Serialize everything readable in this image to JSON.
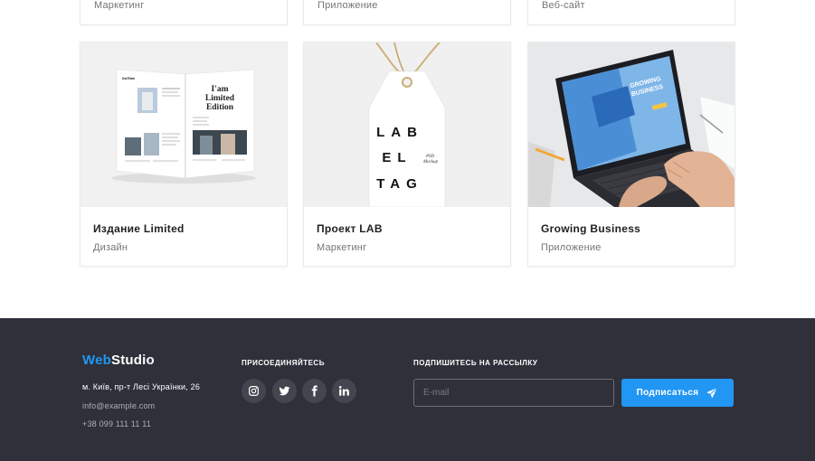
{
  "top_row": {
    "items": [
      {
        "category": "Маркетинг"
      },
      {
        "category": "Приложение"
      },
      {
        "category": "Веб-сайт"
      }
    ]
  },
  "portfolio": {
    "items": [
      {
        "title": "Издание Limited",
        "category": "Дизайн"
      },
      {
        "title": "Проект LAB",
        "category": "Маркетинг"
      },
      {
        "title": "Growing Business",
        "category": "Приложение"
      }
    ],
    "images": {
      "magazine": {
        "headline": "I'am Limited Edition",
        "brand": "Dal'Edm"
      },
      "label_tag": {
        "lines": [
          "LAB",
          "EL",
          "TAG"
        ],
        "note": "PSD Mockup"
      },
      "laptop": {
        "headline": "GROWING BUSINESS"
      }
    }
  },
  "footer": {
    "logo": {
      "part1": "Web",
      "part2": "Studio"
    },
    "address": "м. Київ, пр-т Лесі Українки, 26",
    "email": "info@example.com",
    "phone": "+38 099 111 11 11",
    "social_heading": "ПРИСОЕДИНЯЙТЕСЬ",
    "social_icons": [
      "instagram-icon",
      "twitter-icon",
      "facebook-icon",
      "linkedin-icon"
    ],
    "subscribe_heading": "ПОДПИШИТЕСЬ НА РАССЫЛКУ",
    "email_placeholder": "E-mail",
    "subscribe_label": "Подписаться"
  },
  "colors": {
    "accent": "#2196f3",
    "footer_bg": "#2f303a",
    "text_dark": "#212121",
    "text_muted": "#757575"
  }
}
